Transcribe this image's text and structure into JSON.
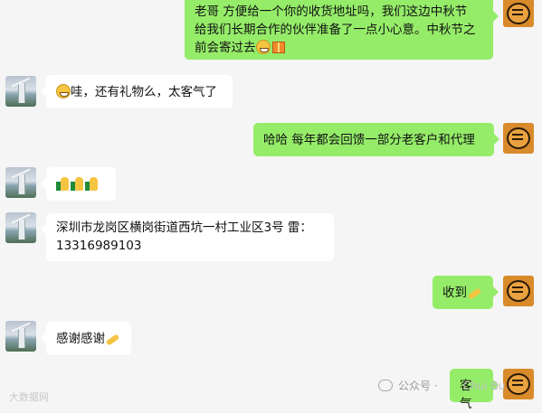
{
  "messages": [
    {
      "side": "me",
      "text_line1": "老哥 方便给一个你的收货地址吗，我们这边中秋节",
      "text_line2": "给我们长期合作的伙伴准备了一点小心意。中秋节之",
      "text_line3": "前会寄过去"
    },
    {
      "side": "other",
      "text": "哇，还有礼物么，太客气了"
    },
    {
      "side": "me",
      "text": "哈哈 每年都会回馈一部分老客户和代理"
    },
    {
      "side": "other",
      "text": ""
    },
    {
      "side": "other",
      "text_line1": "深圳市龙岗区横岗街道西坑一村工业区3号   雷：",
      "text_line2": "13316989103"
    },
    {
      "side": "me",
      "text": "收到"
    },
    {
      "side": "other",
      "text": "感谢感谢"
    },
    {
      "side": "me",
      "text": "客气"
    }
  ],
  "footer": {
    "account_label": "公众号 · ",
    "account_name": "Chui Bu"
  },
  "watermark": "大数据网"
}
